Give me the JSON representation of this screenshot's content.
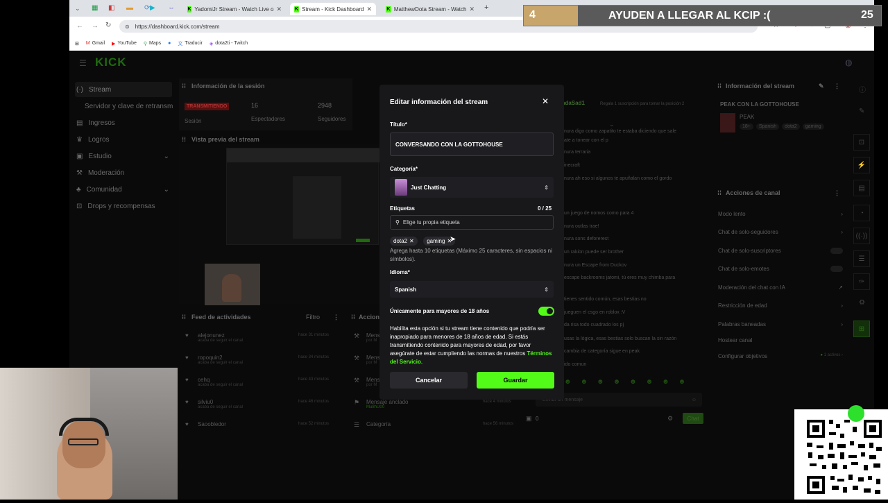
{
  "browser": {
    "tabs": [
      {
        "title": "YadomiJr Stream - Watch Live o"
      },
      {
        "title": "Stream - Kick Dashboard"
      },
      {
        "title": "MatthewDota Stream - Watch"
      }
    ],
    "url": "https://dashboard.kick.com/stream",
    "bookmarks": [
      "Gmail",
      "YouTube",
      "Maps",
      "Traducir",
      "dota2ti - Twitch"
    ]
  },
  "overlay": {
    "banner_left": "4",
    "banner_text": "AYUDEN A LLEGAR AL KCIP :(",
    "banner_right": "25"
  },
  "dashboard": {
    "logo": "KICK",
    "sidebar": {
      "items": [
        {
          "label": "Stream",
          "icon": "stream-icon"
        },
        {
          "label": "Servidor y clave de retransm"
        },
        {
          "label": "Ingresos",
          "icon": "money-icon"
        },
        {
          "label": "Logros",
          "icon": "trophy-icon"
        },
        {
          "label": "Estudio",
          "icon": "studio-icon"
        },
        {
          "label": "Moderación",
          "icon": "hammer-icon"
        },
        {
          "label": "Comunidad",
          "icon": "community-icon"
        },
        {
          "label": "Drops y recompensas",
          "icon": "gift-icon"
        }
      ]
    },
    "session": {
      "title": "Información de la sesión",
      "status": "TRANSMITIENDO",
      "status_label": "Sesión",
      "viewers": "16",
      "viewers_label": "Espectadores",
      "followers": "2948",
      "followers_label": "Seguidores"
    },
    "preview_title": "Vista previa del stream",
    "feed": {
      "title": "Feed de actividades",
      "filter": "Filtro",
      "items": [
        {
          "name": "alejonunez",
          "sub": "acaba de seguir el canal",
          "time": "hace 31 minutos"
        },
        {
          "name": "ropoquin2",
          "sub": "acaba de seguir el canal",
          "time": "hace 34 minutos"
        },
        {
          "name": "cehq",
          "sub": "acaba de seguir el canal",
          "time": "hace 43 minutos"
        },
        {
          "name": "silviu0",
          "sub": "acaba de seguir el canal",
          "time": "hace 46 minutos"
        },
        {
          "name": "Saoobledor",
          "sub": "",
          "time": "hace 52 minutos"
        }
      ]
    },
    "actions_feed": {
      "title": "Acciones",
      "items": [
        {
          "name": "Mens",
          "sub": "por M"
        },
        {
          "name": "Mens",
          "sub": "por M"
        },
        {
          "name": "Mens",
          "sub": "por M"
        },
        {
          "name": "Mensaje anclado",
          "sub": "Mu8hU00",
          "time": "hace 4 minutos"
        },
        {
          "name": "Categoría",
          "time": "hace 56 minutos"
        }
      ]
    },
    "chat": {
      "user": "adaSad1",
      "note": "Regala 1 suscripción para tomar la posición 2",
      "lines": [
        "nura digo como zapatito te estaba diciendo que sale",
        "ate a tonear con el p",
        "nura terraria",
        "inecraft",
        "nura ah eso si algunos te apuñalan como el gordo",
        "un juego de nomos como para 4",
        "nura outlas trae!",
        "nura sons deforerest",
        "un rakion puede ser brother",
        "nura un Escape from Duckov",
        "escape backrooms jatomi, tú eres muy chimba para",
        "tienes sentido común, esas bestias no",
        "jueguen el csgo en roblox :V",
        "da risa todo cuadrado los pj",
        "usas la lógica, esas bestias solo buscan la sin razón",
        "cambia de categoría sigue en peak",
        "ido comun"
      ],
      "input_placeholder": "Enviar un mensaje",
      "count": "0",
      "send": "Chat"
    },
    "stream_info": {
      "title": "Información del stream",
      "stream_title": "PEAK CON LA GOTTOHOUSE",
      "category": "PEAK",
      "tags": [
        "18+",
        "Spanish",
        "dota2",
        "gaming"
      ]
    },
    "channel_actions": {
      "title": "Acciones de canal",
      "items": [
        {
          "label": "Modo lento"
        },
        {
          "label": "Chat de solo-seguidores"
        },
        {
          "label": "Chat de solo-suscriptores"
        },
        {
          "label": "Chat de solo-emotes"
        },
        {
          "label": "Moderación del chat con IA"
        },
        {
          "label": "Restricción de edad"
        },
        {
          "label": "Palabras baneadas"
        },
        {
          "label": "Hostear canal"
        },
        {
          "label": "Configurar objetivos",
          "extra": "1 activos"
        }
      ]
    }
  },
  "modal": {
    "title": "Editar información del stream",
    "title_label": "Título*",
    "title_value": "CONVERSANDO CON LA GOTTOHOUSE",
    "category_label": "Categoría*",
    "category_value": "Just Chatting",
    "tags_label": "Etiquetas",
    "tags_count": "0 / 25",
    "tags_placeholder": "Elige tu propia etiqueta",
    "tags": [
      "dota2",
      "gaming"
    ],
    "tags_help": "Agrega hasta 10 etiquetas (Máximo 25 caracteres, sin espacios ni símbolos).",
    "language_label": "Idioma*",
    "language_value": "Spanish",
    "mature_label": "Únicamente para mayores de 18 años",
    "mature_on": true,
    "mature_help": "Habilita esta opción si tu stream tiene contenido que podría ser inapropiado para menores de 18 años de edad. Si estás transmitiendo contenido para mayores de edad, por favor asegúrate de estar cumpliendo las normas de nuestros",
    "terms_link": "Términos del Servicio",
    "terms_end": ".",
    "cancel": "Cancelar",
    "save": "Guardar"
  },
  "colors": {
    "accent": "#53fc18",
    "live": "#e91916",
    "modal_bg": "#18181b"
  }
}
